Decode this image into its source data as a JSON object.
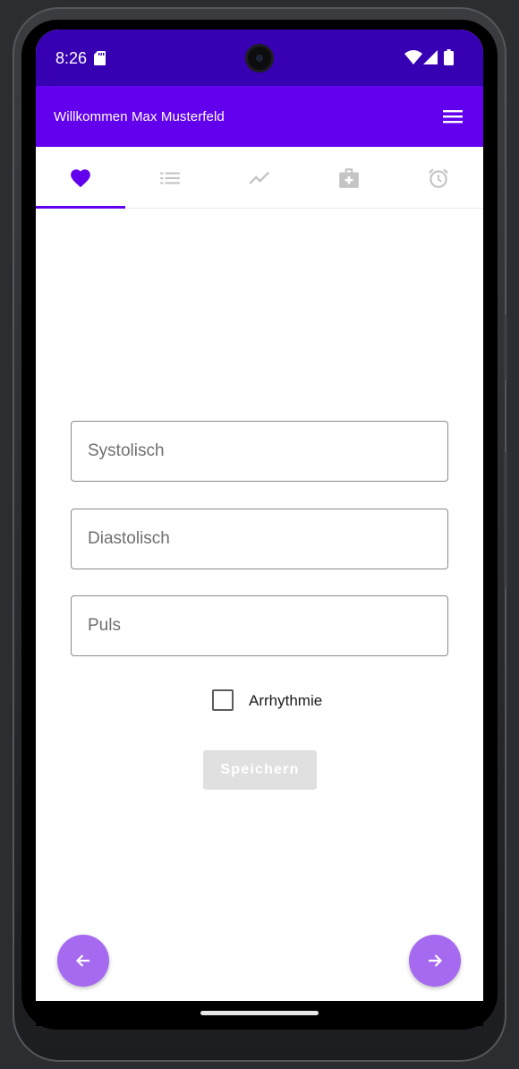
{
  "status_bar": {
    "time": "8:26",
    "icons": [
      "sd-card-icon",
      "wifi-icon",
      "signal-icon",
      "battery-icon"
    ]
  },
  "app_bar": {
    "title": "Willkommen Max Musterfeld",
    "menu_icon": "hamburger-menu-icon"
  },
  "tabs": [
    {
      "icon": "heart-icon",
      "selected": true
    },
    {
      "icon": "list-icon",
      "selected": false
    },
    {
      "icon": "trending-icon",
      "selected": false
    },
    {
      "icon": "medical-bag-icon",
      "selected": false
    },
    {
      "icon": "alarm-clock-icon",
      "selected": false
    }
  ],
  "form": {
    "systolic": {
      "placeholder": "Systolisch",
      "value": ""
    },
    "diastolic": {
      "placeholder": "Diastolisch",
      "value": ""
    },
    "pulse": {
      "placeholder": "Puls",
      "value": ""
    },
    "arrhythmia": {
      "label": "Arrhythmie",
      "checked": false
    },
    "save_label": "Speichern"
  },
  "navigation": {
    "back_icon": "arrow-left-icon",
    "forward_icon": "arrow-right-icon"
  },
  "colors": {
    "status_bar": "#3700b3",
    "app_bar": "#6200ee",
    "tab_active": "#6200ee",
    "tab_inactive": "#c4c4c4",
    "fab": "#a66af0",
    "button_disabled": "#e0e0e0"
  }
}
